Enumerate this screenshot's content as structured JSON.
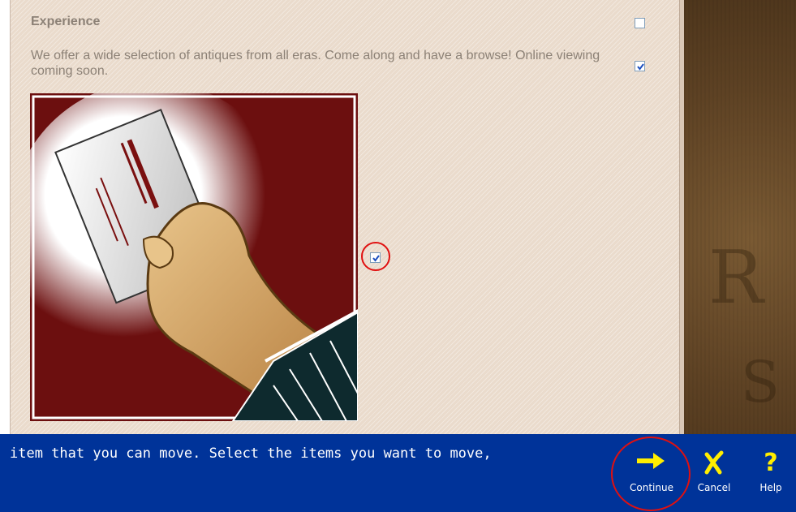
{
  "section": {
    "heading": "Experience",
    "description": "We offer a wide selection of antiques from all eras. Come along and have a browse! Online viewing coming soon."
  },
  "checkboxes": {
    "heading_checked": false,
    "description_checked": true,
    "image_checked": true
  },
  "image": {
    "alt": "hand-holding-business-card-illustration"
  },
  "footer": {
    "instruction": "item that you can move. Select the items you want to move,",
    "continue_label": "Continue",
    "cancel_label": "Cancel",
    "help_label": "Help"
  },
  "colors": {
    "panel_bg": "#eadbcc",
    "bar_bg": "#003399",
    "accent_yellow": "#ffee00",
    "annotation_red": "#e01010"
  }
}
